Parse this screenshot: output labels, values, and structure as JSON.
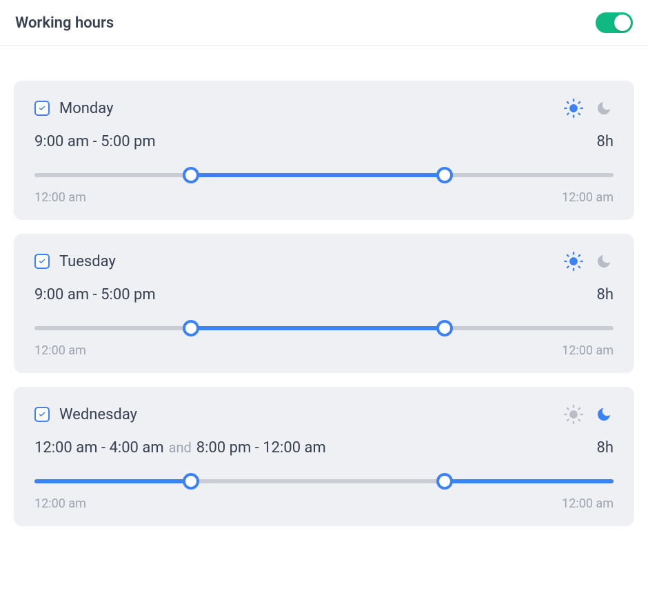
{
  "header": {
    "title": "Working hours",
    "toggle_on": true
  },
  "scale": {
    "start_label": "12:00 am",
    "end_label": "12:00 am"
  },
  "days": [
    {
      "name": "Monday",
      "checked": true,
      "mode": "day",
      "ranges_text": [
        "9:00 am - 5:00 pm"
      ],
      "duration": "8h",
      "segments": [
        {
          "start_pct": 27,
          "end_pct": 70.8
        }
      ]
    },
    {
      "name": "Tuesday",
      "checked": true,
      "mode": "day",
      "ranges_text": [
        "9:00 am - 5:00 pm"
      ],
      "duration": "8h",
      "segments": [
        {
          "start_pct": 27,
          "end_pct": 70.8
        }
      ]
    },
    {
      "name": "Wednesday",
      "checked": true,
      "mode": "night",
      "ranges_text": [
        "12:00 am - 4:00 am",
        "8:00 pm - 12:00 am"
      ],
      "duration": "8h",
      "segments": [
        {
          "start_pct": 0,
          "end_pct": 27,
          "show_start_handle": false
        },
        {
          "start_pct": 70.8,
          "end_pct": 100,
          "show_end_handle": false
        }
      ]
    }
  ]
}
